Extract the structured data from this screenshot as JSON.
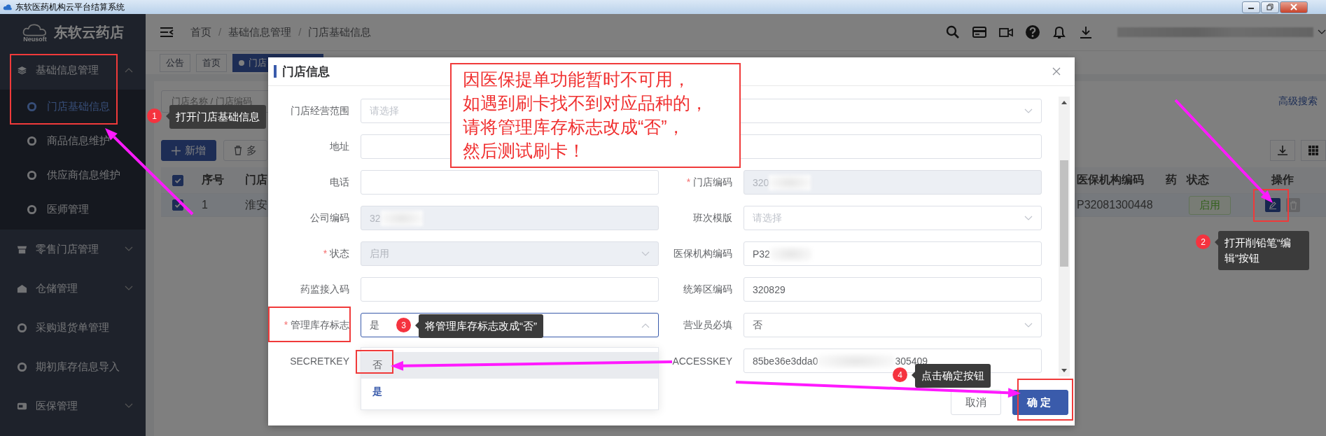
{
  "window": {
    "title": "东软医药机构云平台结算系统"
  },
  "sidebar": {
    "logo": "东软云药店",
    "logo_mark": "Neusoft",
    "menu": [
      {
        "label": "基础信息管理",
        "expanded": true,
        "children": [
          {
            "label": "门店基础信息",
            "selected": true
          },
          {
            "label": "商品信息维护",
            "selected": false
          },
          {
            "label": "供应商信息维护",
            "selected": false
          },
          {
            "label": "医师管理",
            "selected": false
          }
        ]
      },
      {
        "label": "零售门店管理",
        "expanded": false
      },
      {
        "label": "仓储管理",
        "expanded": false
      },
      {
        "label": "采购退货单管理"
      },
      {
        "label": "期初库存信息导入"
      },
      {
        "label": "医保管理",
        "expanded": false
      }
    ]
  },
  "header": {
    "breadcrumb": [
      {
        "text": "首页",
        "kind": "link"
      },
      {
        "text": "/",
        "kind": "separator"
      },
      {
        "text": "基础信息管理",
        "kind": "link"
      },
      {
        "text": "/",
        "kind": "separator"
      },
      {
        "text": "门店基础信息",
        "kind": "link"
      }
    ]
  },
  "tags": [
    {
      "label": "公告",
      "selected": false
    },
    {
      "label": "首页",
      "selected": false
    },
    {
      "label": "门店",
      "selected": true
    }
  ],
  "list_page": {
    "search_placeholder": "门店名称 / 门店编码",
    "advanced_search": "高级搜索",
    "buttons": [
      {
        "label": "新增",
        "kind": "primary"
      },
      {
        "label": "多",
        "kind": "delete"
      }
    ],
    "table": {
      "select_all": {
        "checked": true
      },
      "columns": [
        "序号",
        "门店",
        "医保机构编码",
        "药",
        "状态",
        "操作"
      ],
      "rows": [
        {
          "checked": true,
          "index": "1",
          "store": "淮安",
          "insurance_code": "P32081300448",
          "status": "启用"
        }
      ]
    }
  },
  "dialog": {
    "title": "门店信息",
    "fields": [
      {
        "label": "门店经营范围",
        "kind": "select",
        "wide": true,
        "placeholder": "请选择",
        "disabled": false
      },
      {
        "label": "地址",
        "kind": "input",
        "wide": true,
        "disabled": false
      },
      {
        "label": "电话",
        "kind": "input",
        "disabled": false
      },
      {
        "label": "门店编码",
        "mark": "*",
        "kind": "input",
        "disabled": true,
        "value": "320",
        "redacted": true
      },
      {
        "label": "公司编码",
        "kind": "input",
        "disabled": true,
        "value": "32",
        "redacted": true
      },
      {
        "label": "班次模版",
        "kind": "select",
        "placeholder": "请选择",
        "disabled": false
      },
      {
        "label": "状态",
        "mark": "*",
        "kind": "select",
        "disabled": true,
        "value": "启用"
      },
      {
        "label": "医保机构编码",
        "kind": "input",
        "disabled": false,
        "value": "P32",
        "redacted": true
      },
      {
        "label": "药监接入码",
        "kind": "input",
        "disabled": false
      },
      {
        "label": "统筹区编码",
        "kind": "input",
        "disabled": false,
        "value": "320829"
      },
      {
        "label": "管理库存标志",
        "mark": "*",
        "kind": "select",
        "disabled": false,
        "value": "是",
        "open": true,
        "options": [
          {
            "label": "否",
            "highlighted": true,
            "selected": false
          },
          {
            "label": "是",
            "highlighted": false,
            "selected": true
          }
        ]
      },
      {
        "label": "营业员必填",
        "kind": "select",
        "disabled": false,
        "value": "否"
      },
      {
        "label": "SECRETKEY",
        "kind": "covered"
      },
      {
        "label": "ACCESSKEY",
        "kind": "input",
        "disabled": false,
        "value": "85be36e3dda0",
        "redacted": true,
        "value_end": "305409"
      }
    ],
    "buttons": [
      {
        "label": "取消",
        "kind": "default"
      },
      {
        "label": "确定",
        "kind": "primary"
      }
    ]
  },
  "note": {
    "lines": [
      "因医保提单功能暂时不可用，",
      "如遇到刷卡找不到对应品种的，",
      "请将管理库存标志改成“否”，",
      "然后测试刷卡！"
    ]
  },
  "steps": [
    {
      "number": "1",
      "text": "打开门店基础信息"
    },
    {
      "number": "2",
      "text": "打开削铅笔“编辑”按钮"
    },
    {
      "number": "3",
      "text": "将管理库存标志改成“否”"
    },
    {
      "number": "4",
      "text": "点击确定按钮"
    }
  ]
}
